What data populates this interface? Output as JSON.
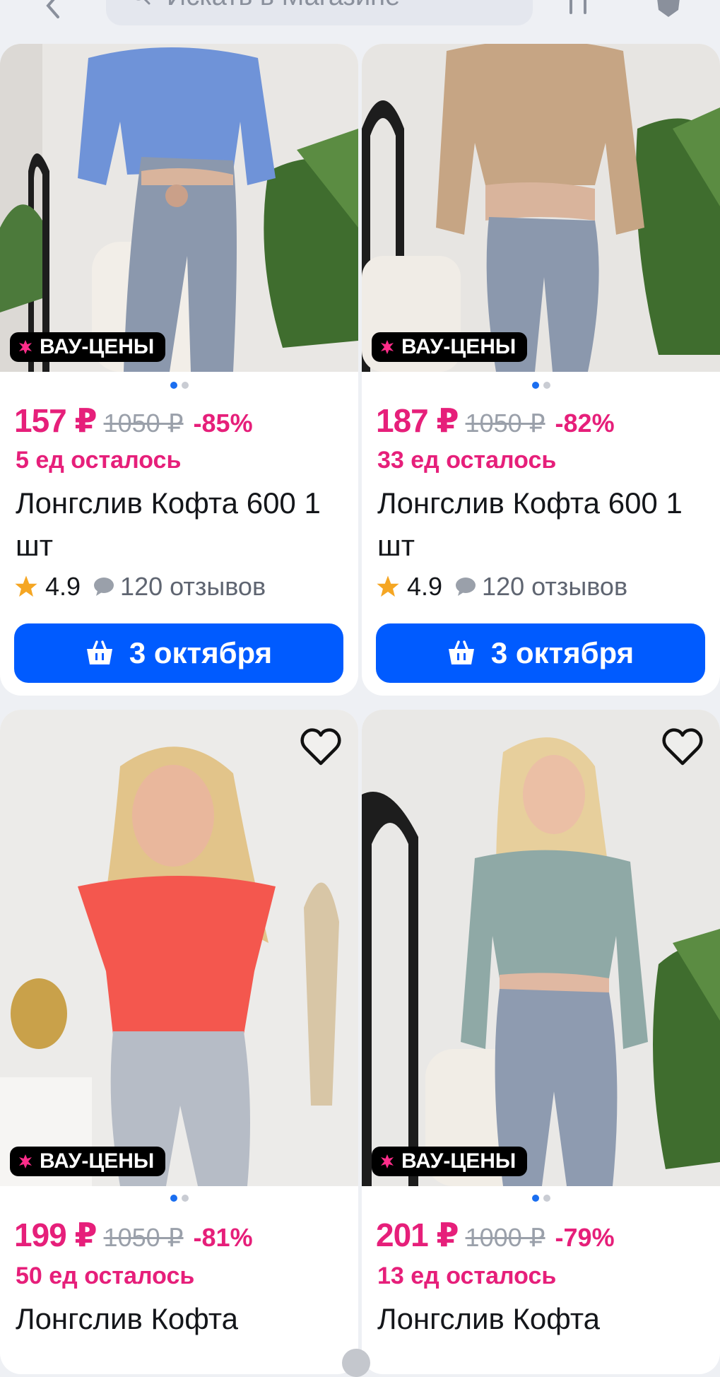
{
  "search": {
    "placeholder": "Искать в Магазине"
  },
  "badge_label": "ВАУ-ЦЕНЫ",
  "colors": {
    "accent_pink": "#e61f7a",
    "button_blue": "#005bff",
    "badge_black": "#000000"
  },
  "products": [
    {
      "price": "157 ₽",
      "old_price": "1050 ₽",
      "discount": "-85%",
      "stock": "5 ед осталось",
      "title": "Лонгслив Кофта 600 1 шт",
      "rating": "4.9",
      "reviews": "120 отзывов",
      "delivery": "3 октября",
      "image": "woman-blue-longsleeve-jeans",
      "favorite_icon": "heart-outline-icon"
    },
    {
      "price": "187 ₽",
      "old_price": "1050 ₽",
      "discount": "-82%",
      "stock": "33 ед осталось",
      "title": "Лонгслив Кофта 600 1 шт",
      "rating": "4.9",
      "reviews": "120 отзывов",
      "delivery": "3 октября",
      "image": "woman-beige-longsleeve-jeans",
      "favorite_icon": "heart-outline-icon"
    },
    {
      "price": "199 ₽",
      "old_price": "1050 ₽",
      "discount": "-81%",
      "stock": "50 ед осталось",
      "title": "Лонгслив Кофта",
      "image": "woman-red-tshirt-jeans",
      "favorite_icon": "heart-outline-icon"
    },
    {
      "price": "201 ₽",
      "old_price": "1000 ₽",
      "discount": "-79%",
      "stock": "13 ед осталось",
      "title": "Лонгслив Кофта",
      "image": "woman-sage-longsleeve-jeans",
      "favorite_icon": "heart-outline-icon"
    }
  ]
}
